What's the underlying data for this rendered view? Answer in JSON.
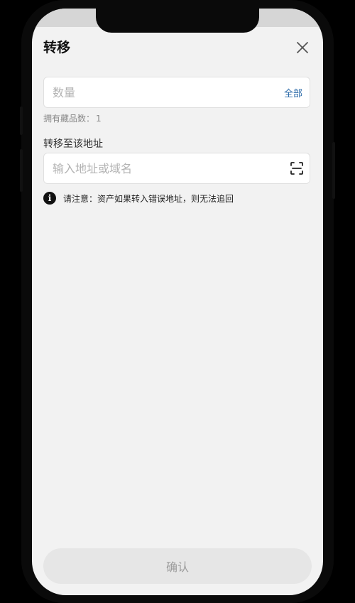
{
  "header": {
    "title": "转移"
  },
  "quantity": {
    "placeholder": "数量",
    "value": "",
    "all_label": "全部"
  },
  "owned": {
    "label": "拥有藏品数：",
    "count": "1"
  },
  "address": {
    "label": "转移至该地址",
    "placeholder": "输入地址或域名",
    "value": ""
  },
  "notice": {
    "text": "请注意：资产如果转入错误地址，则无法追回"
  },
  "footer": {
    "confirm_label": "确认"
  },
  "icons": {
    "close": "close-icon",
    "scan": "scan-icon",
    "info": "info-icon"
  },
  "colors": {
    "accent": "#2b6aa8",
    "background": "#f2f2f2",
    "button_disabled_bg": "#e6e6e6",
    "button_disabled_text": "#9b9b9b"
  }
}
